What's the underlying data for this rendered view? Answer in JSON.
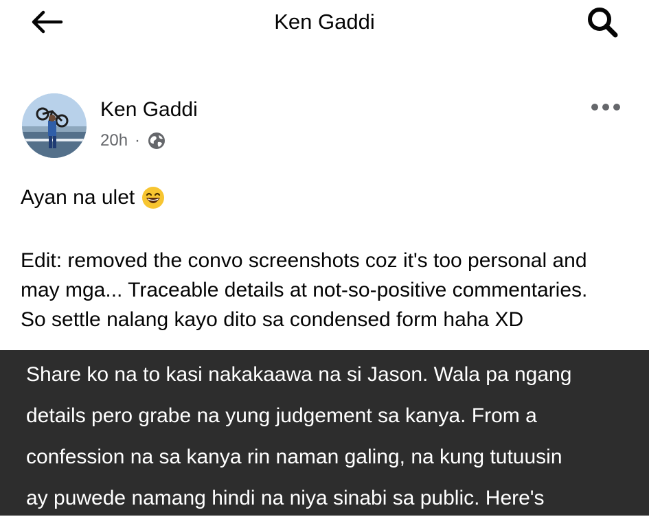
{
  "header": {
    "title": "Ken Gaddi",
    "back_icon": "arrow-left-icon",
    "search_icon": "search-icon"
  },
  "post": {
    "author": "Ken Gaddi",
    "time": "20h",
    "separator": "·",
    "audience_icon": "globe-icon",
    "more_icon": "more-horizontal-icon",
    "text_line": "Ayan na ulet",
    "emoji_icon": "grinning-face-emoji",
    "edit_lines": [
      "Edit: removed the convo screenshots coz it's too personal and",
      "may mga... Traceable details at not-so-positive commentaries.",
      "So settle nalang kayo dito sa condensed form haha XD"
    ]
  },
  "shared_image": {
    "background": "#2d2d2d",
    "lines": [
      "Share ko na to kasi nakakaawa na si Jason. Wala pa ngang",
      "details pero grabe na yung judgement sa kanya. From a",
      "confession na sa kanya rin naman galing, na kung tutuusin",
      "ay puwede namang hindi na niya sinabi sa public. Here's"
    ]
  }
}
